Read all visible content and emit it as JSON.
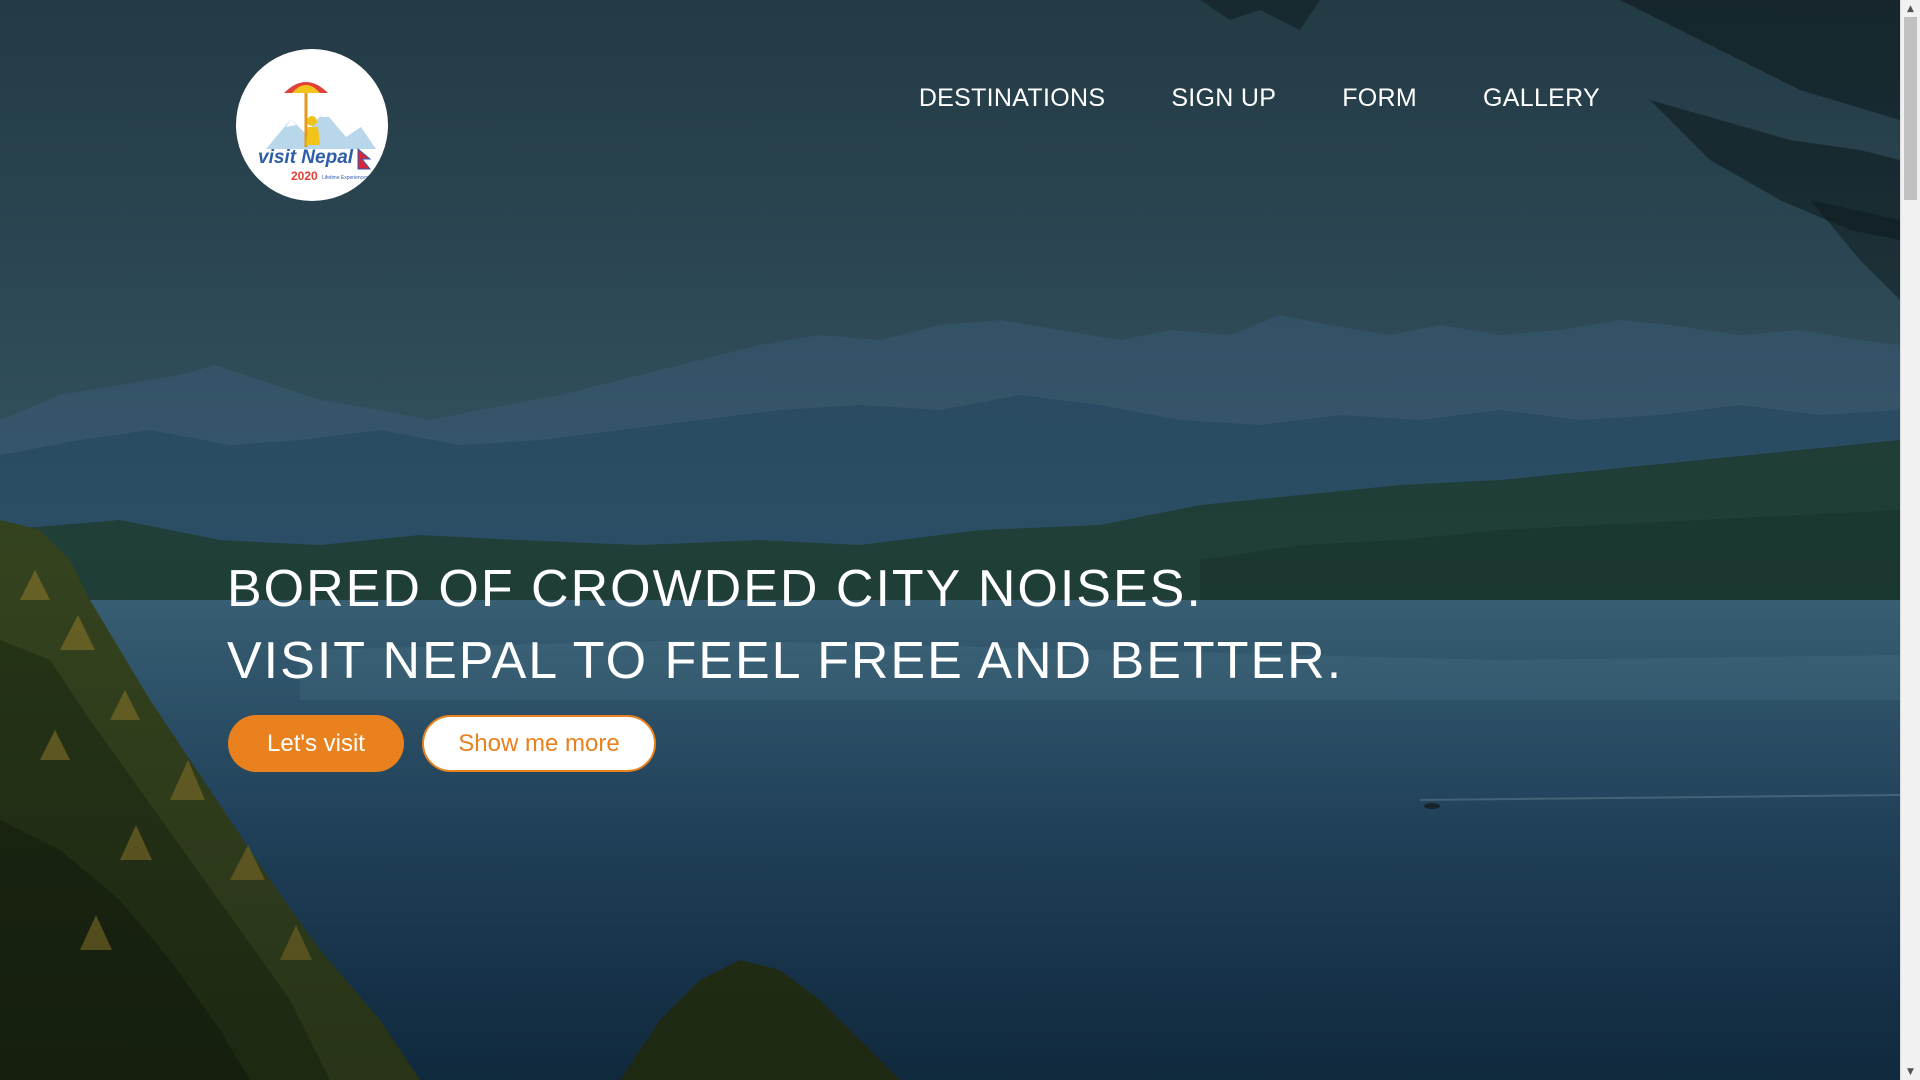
{
  "logo": {
    "name": "visit-nepal-2020-logo",
    "text_main": "visit Nepal",
    "text_year": "2020",
    "text_tagline": "Lifetime Experiences"
  },
  "nav": {
    "items": [
      {
        "label": "DESTINATIONS"
      },
      {
        "label": "SIGN UP"
      },
      {
        "label": "FORM"
      },
      {
        "label": "GALLERY"
      }
    ]
  },
  "hero": {
    "headline_line1": "BORED OF CROWDED CITY NOISES.",
    "headline_line2": "VISIT NEPAL TO FEEL FREE AND BETTER.",
    "primary_button": "Let's visit",
    "secondary_button": "Show me more",
    "background_image": "mountain-lake-forest"
  },
  "colors": {
    "accent": "#e8811e",
    "text": "#ffffff",
    "logo_bg": "#ffffff"
  },
  "scrollbar": {
    "up_icon": "▲",
    "down_icon": "▼"
  }
}
